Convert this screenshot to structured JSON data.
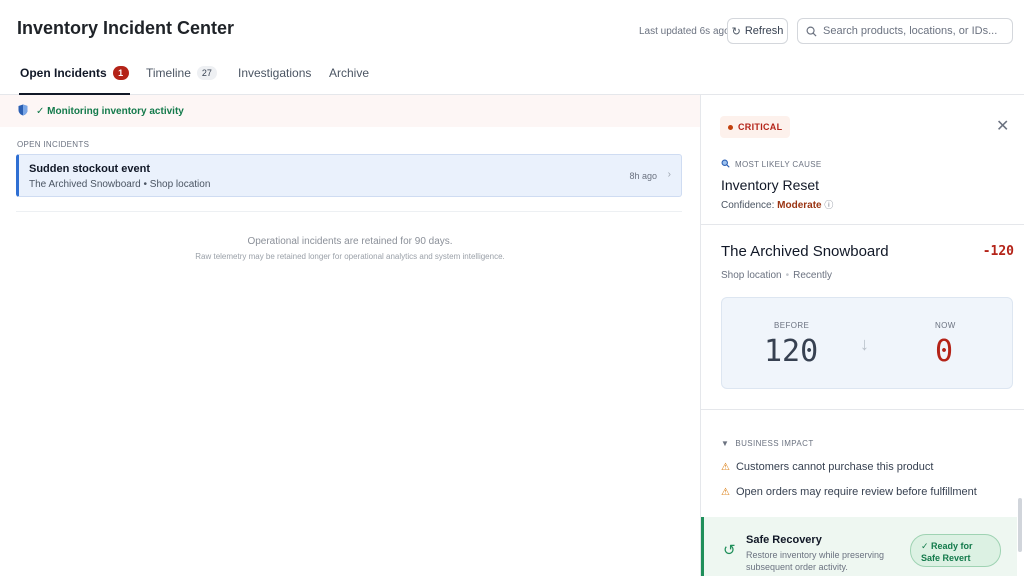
{
  "header": {
    "title": "Inventory Incident Center",
    "last_updated": "Last updated 6s ago",
    "refresh_label": "Refresh",
    "search_placeholder": "Search products, locations, or IDs..."
  },
  "tabs": [
    {
      "label": "Open Incidents",
      "badge": "1",
      "active": true
    },
    {
      "label": "Timeline",
      "badge": "27",
      "active": false
    },
    {
      "label": "Investigations",
      "active": false
    },
    {
      "label": "Archive",
      "active": false
    }
  ],
  "monitor": {
    "text": "✓ Monitoring inventory activity",
    "icon": "shield-icon"
  },
  "incidents_section": {
    "label": "OPEN INCIDENTS",
    "items": [
      {
        "title": "Sudden stockout event",
        "subtitle": "The Archived Snowboard • Shop location",
        "time": "8h ago"
      }
    ]
  },
  "retention": {
    "line1": "Operational incidents are retained for 90 days.",
    "line2": "Raw telemetry may be retained longer for operational analytics and system intelligence."
  },
  "detail": {
    "severity": "CRITICAL",
    "cause_label": "MOST LIKELY CAUSE",
    "cause_title": "Inventory Reset",
    "confidence_label": "Confidence:",
    "confidence_level": "Moderate",
    "product_name": "The Archived Snowboard",
    "delta": "-120",
    "location": "Shop location",
    "when": "Recently",
    "before_label": "BEFORE",
    "before_value": "120",
    "now_label": "NOW",
    "now_value": "0",
    "impact_label": "BUSINESS IMPACT",
    "impacts": [
      "Customers cannot purchase this product",
      "Open orders may require review before fulfillment"
    ],
    "recovery_title": "Safe Recovery",
    "recovery_desc": "Restore inventory while preserving subsequent order activity.",
    "ready_label": "✓ Ready for Safe Revert"
  },
  "colors": {
    "critical": "#b42318",
    "success": "#1f8f5a",
    "accent": "#2f6fd3"
  }
}
